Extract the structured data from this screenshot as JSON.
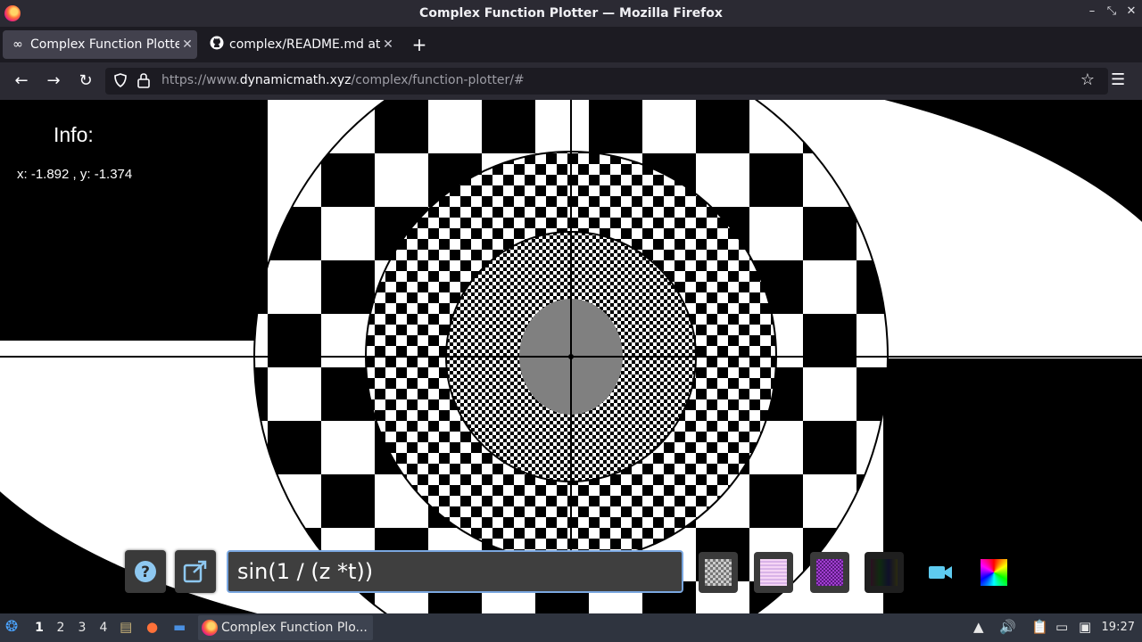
{
  "window": {
    "title": "Complex Function Plotter — Mozilla Firefox"
  },
  "tabs": [
    {
      "label": "Complex Function Plotter",
      "icon": "infinity-icon",
      "active": true
    },
    {
      "label": "complex/README.md at",
      "icon": "github-icon",
      "active": false
    }
  ],
  "nav": {
    "url_prefix": "https://www.",
    "url_domain": "dynamicmath.xyz",
    "url_path": "/complex/function-plotter/#"
  },
  "info": {
    "heading": "Info:",
    "coords": "x: -1.892 , y: -1.374"
  },
  "toolbar": {
    "expression": "sin(1 / (z *t))",
    "help_icon": "question-icon",
    "open_icon": "external-link-icon",
    "camera_icon": "video-camera-icon",
    "color_icon": "color-wheel-icon"
  },
  "taskbar": {
    "desktops": [
      "1",
      "2",
      "3",
      "4"
    ],
    "active_desktop": "1",
    "app_label": "Complex Function Plo...",
    "clock": "19:27"
  },
  "colors": {
    "accent": "#7aa7e0",
    "camera": "#5ecbf0"
  }
}
